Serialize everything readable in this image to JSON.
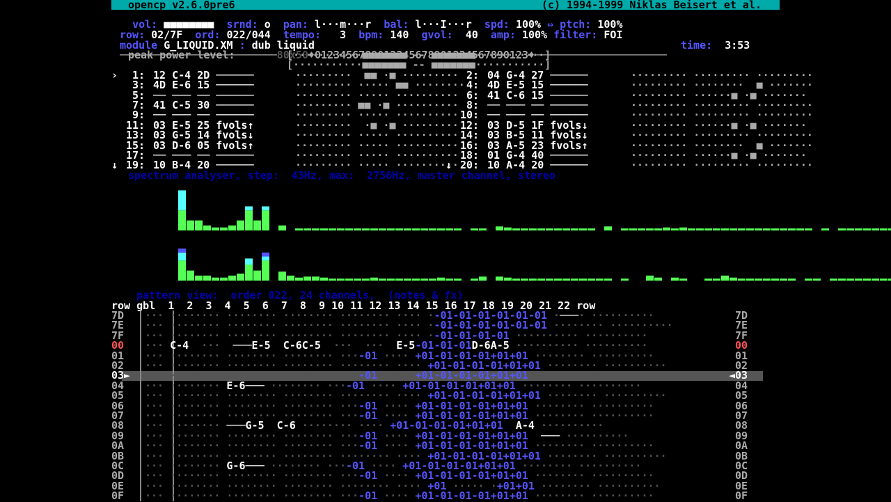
{
  "title": {
    "left": "opencp v2.6.0pre6",
    "right": "(c) 1994-1999 Niklas Beisert et al."
  },
  "header": {
    "line1": [
      {
        "label": "vol:",
        "value": "■■■■■■■■"
      },
      {
        "label": "srnd:",
        "value": "o"
      },
      {
        "label": "pan:",
        "value": "l···m···r"
      },
      {
        "label": "bal:",
        "value": "l···I···r"
      },
      {
        "label": "spd:",
        "value": "100%"
      },
      {
        "label": "⇔ ptch:",
        "value": "100%"
      }
    ],
    "row_label": "row:",
    "row_value": "02/7F",
    "ord_label": "ord:",
    "ord_value": "022/044",
    "tempo_label": "tempo:",
    "tempo_value": "3",
    "bpm_label": "bpm:",
    "bpm_value": "140",
    "gvol_label": "gvol:",
    "gvol_value": "40",
    "amp_label": "amp:",
    "amp_value": "100%",
    "filter_label": "filter:",
    "filter_value": "FOI",
    "module_label": "module",
    "module_value": "G_LIQUID.XM",
    "module_sep": ":",
    "song_title": "dub liquid",
    "time_label": "time:",
    "time_value": "3:53"
  },
  "divider": {
    "mode": "80x50",
    "channels": "♦0123456789012345678901234567890123♦",
    "left_dashes": "─────────────────────────",
    "right_dashes": "─────────────────────"
  },
  "peak": {
    "label": "peak power level:",
    "l_row": "[···········■■■■■■■ -- ■■■■■■■···········]",
    "r_row": "[···········■■■■■■■ -- ■■■■■■■···········]"
  },
  "channels_left": [
    {
      "cursor": "›",
      "num": "1:",
      "text": "12 C-4 2D ──────",
      "meter": "·········  ■■ ·■ ·········"
    },
    {
      "cursor": "",
      "num": "3:",
      "text": "4D E-6 15 ──────",
      "meter": "········· ····· ■■ ········"
    },
    {
      "cursor": "",
      "num": "5:",
      "text": "── ─── ── ──────",
      "meter": "········· ····· ··········"
    },
    {
      "cursor": "",
      "num": "7:",
      "text": "41 C-5 30 ──────",
      "meter": "········· ■■ ·■ ··········"
    },
    {
      "cursor": "",
      "num": "9:",
      "text": "── ─── ── ──────",
      "meter": "········· ····· ··········"
    },
    {
      "cursor": "",
      "num": "11:",
      "text": "03 E-5 25 fvols↑",
      "meter": "·········  ·■ ·■ ·········"
    },
    {
      "cursor": "",
      "num": "13:",
      "text": "03 G-5 14 fvols↓",
      "meter": "········· ····· ··········"
    },
    {
      "cursor": "",
      "num": "15:",
      "text": "03 D-6 05 fvols↑",
      "meter": "········· ····· ··········"
    },
    {
      "cursor": "",
      "num": "17:",
      "text": "── ─── ── ──────",
      "meter": "········· ····· ··········"
    },
    {
      "cursor": "↓",
      "num": "19:",
      "text": "10 B-4 20 ──────",
      "meter": "········· ····· ··········"
    }
  ],
  "channels_right": [
    {
      "cursor": "",
      "num": "2:",
      "text": "04 G-4 27 ──────",
      "meter": "········· ········· ·········"
    },
    {
      "cursor": "",
      "num": "4:",
      "text": "4D E-5 15 ──────",
      "meter": "········· ········  ■ ·······"
    },
    {
      "cursor": "",
      "num": "6:",
      "text": "41 C-6 15 ──────",
      "meter": "········· ······■ ·■ ·······"
    },
    {
      "cursor": "",
      "num": "8:",
      "text": "── ─── ── ──────",
      "meter": "········· ········· ·········"
    },
    {
      "cursor": "",
      "num": "10:",
      "text": "── ─── ── ──────",
      "meter": "········· ········· ·········"
    },
    {
      "cursor": "",
      "num": "12:",
      "text": "03 D-5 1F fvols↓",
      "meter": "········· ······■ ·■ ·······"
    },
    {
      "cursor": "",
      "num": "14:",
      "text": "03 B-5 11 fvols↓",
      "meter": "········· ········· ·········"
    },
    {
      "cursor": "",
      "num": "16:",
      "text": "03 A-5 23 fvols↑",
      "meter": "········· ········  ■ ·······"
    },
    {
      "cursor": "",
      "num": "18:",
      "text": "01 G-4 40 ──────",
      "meter": "········· ······■ ·■ ·······"
    },
    {
      "cursor": "↓",
      "num": "20:",
      "text": "10 A-4 20 ──────",
      "meter": "········· ········· ·········"
    }
  ],
  "spectrum": {
    "title": "spectrum analyser, step:  43Hz, max:  2756Hz, master channel, stereo",
    "colors": {
      "green": "#55ff55",
      "cyan": "#55ffff",
      "blue": "#5555ff"
    },
    "top_bars": [
      {
        "g": 2,
        "c": 2,
        "b": 0
      },
      {
        "g": 1,
        "c": 0,
        "b": 0
      },
      {
        "g": 1,
        "c": 0,
        "b": 0
      },
      {
        "g": 0.5,
        "c": 0,
        "b": 0
      },
      {
        "g": 0.3,
        "c": 0,
        "b": 0
      },
      {
        "g": 0.3,
        "c": 0,
        "b": 0
      },
      {
        "g": 0.5,
        "c": 0,
        "b": 0
      },
      {
        "g": 1,
        "c": 0,
        "b": 0
      },
      {
        "g": 2,
        "c": 0.4,
        "b": 0
      },
      {
        "g": 1,
        "c": 0,
        "b": 0
      },
      {
        "g": 2,
        "c": 0.4,
        "b": 0
      },
      {
        "g": 0,
        "c": 0,
        "b": 0
      },
      {
        "g": 0.5,
        "c": 0,
        "b": 0
      },
      {
        "g": 0,
        "c": 0,
        "b": 0
      },
      {
        "g": 0.2,
        "c": 0,
        "b": 0
      },
      {
        "g": 0.2,
        "c": 0,
        "b": 0
      },
      {
        "g": 0.2,
        "c": 0,
        "b": 0
      },
      {
        "g": 0.2,
        "c": 0,
        "b": 0
      },
      {
        "g": 0.2,
        "c": 0,
        "b": 0
      },
      {
        "g": 0.2,
        "c": 0,
        "b": 0
      },
      {
        "g": 0.2,
        "c": 0,
        "b": 0
      },
      {
        "g": 0.2,
        "c": 0,
        "b": 0
      },
      {
        "g": 0.2,
        "c": 0,
        "b": 0
      },
      {
        "g": 0.2,
        "c": 0,
        "b": 0
      },
      {
        "g": 0.2,
        "c": 0,
        "b": 0
      },
      {
        "g": 0.2,
        "c": 0,
        "b": 0
      },
      {
        "g": 0.2,
        "c": 0,
        "b": 0
      },
      {
        "g": 0.2,
        "c": 0,
        "b": 0
      },
      {
        "g": 0.2,
        "c": 0,
        "b": 0
      },
      {
        "g": 0.2,
        "c": 0,
        "b": 0
      },
      {
        "g": 0.2,
        "c": 0,
        "b": 0
      },
      {
        "g": 0.2,
        "c": 0,
        "b": 0
      },
      {
        "g": 0.2,
        "c": 0,
        "b": 0
      },
      {
        "g": 0.2,
        "c": 0,
        "b": 0
      },
      {
        "g": 0,
        "c": 0,
        "b": 0
      },
      {
        "g": 0.2,
        "c": 0,
        "b": 0
      },
      {
        "g": 0.2,
        "c": 0,
        "b": 0
      },
      {
        "g": 0,
        "c": 0,
        "b": 0
      },
      {
        "g": 0.4,
        "c": 0,
        "b": 0
      },
      {
        "g": 0.3,
        "c": 0,
        "b": 0
      },
      {
        "g": 0.2,
        "c": 0,
        "b": 0
      },
      {
        "g": 0.2,
        "c": 0,
        "b": 0
      },
      {
        "g": 0.2,
        "c": 0,
        "b": 0
      },
      {
        "g": 0.2,
        "c": 0,
        "b": 0
      },
      {
        "g": 0.2,
        "c": 0,
        "b": 0
      },
      {
        "g": 0.2,
        "c": 0,
        "b": 0
      },
      {
        "g": 0.2,
        "c": 0,
        "b": 0
      },
      {
        "g": 0.2,
        "c": 0,
        "b": 0
      },
      {
        "g": 0.2,
        "c": 0,
        "b": 0
      },
      {
        "g": 0.2,
        "c": 0,
        "b": 0
      },
      {
        "g": 0,
        "c": 0,
        "b": 0
      },
      {
        "g": 0.4,
        "c": 0,
        "b": 0
      },
      {
        "g": 0,
        "c": 0,
        "b": 0
      },
      {
        "g": 0.2,
        "c": 0,
        "b": 0
      },
      {
        "g": 0.2,
        "c": 0,
        "b": 0
      },
      {
        "g": 0.2,
        "c": 0,
        "b": 0
      },
      {
        "g": 0.2,
        "c": 0,
        "b": 0
      },
      {
        "g": 0.2,
        "c": 0,
        "b": 0
      },
      {
        "g": 0.3,
        "c": 0,
        "b": 0
      },
      {
        "g": 0.2,
        "c": 0,
        "b": 0
      },
      {
        "g": 0.3,
        "c": 0,
        "b": 0
      },
      {
        "g": 0.2,
        "c": 0,
        "b": 0
      },
      {
        "g": 0.2,
        "c": 0,
        "b": 0
      },
      {
        "g": 0.2,
        "c": 0,
        "b": 0
      },
      {
        "g": 0.2,
        "c": 0,
        "b": 0
      },
      {
        "g": 0.2,
        "c": 0,
        "b": 0
      },
      {
        "g": 0.2,
        "c": 0,
        "b": 0
      },
      {
        "g": 0.2,
        "c": 0,
        "b": 0
      },
      {
        "g": 0.2,
        "c": 0,
        "b": 0
      },
      {
        "g": 0.2,
        "c": 0,
        "b": 0
      },
      {
        "g": 0.2,
        "c": 0,
        "b": 0
      },
      {
        "g": 0.2,
        "c": 0,
        "b": 0
      },
      {
        "g": 0.2,
        "c": 0,
        "b": 0
      },
      {
        "g": 0.2,
        "c": 0,
        "b": 0
      },
      {
        "g": 0.2,
        "c": 0,
        "b": 0
      },
      {
        "g": 0.2,
        "c": 0,
        "b": 0
      },
      {
        "g": 0,
        "c": 0,
        "b": 0
      },
      {
        "g": 0.2,
        "c": 0,
        "b": 0
      },
      {
        "g": 0,
        "c": 0,
        "b": 0
      },
      {
        "g": 0.2,
        "c": 0,
        "b": 0
      },
      {
        "g": 0.2,
        "c": 0,
        "b": 0
      },
      {
        "g": 0.2,
        "c": 0,
        "b": 0
      },
      {
        "g": 0.2,
        "c": 0,
        "b": 0
      },
      {
        "g": 0.2,
        "c": 0,
        "b": 0
      },
      {
        "g": 0.2,
        "c": 0,
        "b": 0
      },
      {
        "g": 0.2,
        "c": 0,
        "b": 0
      },
      {
        "g": 0.2,
        "c": 0,
        "b": 0
      },
      {
        "g": 0.2,
        "c": 0,
        "b": 0
      },
      {
        "g": 0.2,
        "c": 0,
        "b": 0
      },
      {
        "g": 0.2,
        "c": 0,
        "b": 0
      },
      {
        "g": 0.2,
        "c": 0,
        "b": 0
      },
      {
        "g": 0.2,
        "c": 0,
        "b": 0
      }
    ],
    "bottom_bars": [
      {
        "g": 2,
        "c": 0.8,
        "b": 0.4
      },
      {
        "g": 1,
        "c": 0,
        "b": 0
      },
      {
        "g": 0.5,
        "c": 0,
        "b": 0
      },
      {
        "g": 0.5,
        "c": 0,
        "b": 0
      },
      {
        "g": 0.3,
        "c": 0,
        "b": 0
      },
      {
        "g": 0.3,
        "c": 0,
        "b": 0
      },
      {
        "g": 0.5,
        "c": 0,
        "b": 0
      },
      {
        "g": 0.7,
        "c": 0,
        "b": 0
      },
      {
        "g": 1.6,
        "c": 0.6,
        "b": 0
      },
      {
        "g": 1,
        "c": 0,
        "b": 0
      },
      {
        "g": 2,
        "c": 0.4,
        "b": 0.4
      },
      {
        "g": 0,
        "c": 0,
        "b": 0
      },
      {
        "g": 0.9,
        "c": 0,
        "b": 0
      },
      {
        "g": 0.5,
        "c": 0,
        "b": 0
      },
      {
        "g": 0.3,
        "c": 0,
        "b": 0
      },
      {
        "g": 0.4,
        "c": 0,
        "b": 0
      },
      {
        "g": 0.4,
        "c": 0,
        "b": 0
      },
      {
        "g": 0.3,
        "c": 0,
        "b": 0
      },
      {
        "g": 0.2,
        "c": 0,
        "b": 0
      },
      {
        "g": 0.2,
        "c": 0,
        "b": 0
      },
      {
        "g": 0.2,
        "c": 0,
        "b": 0
      },
      {
        "g": 0.2,
        "c": 0,
        "b": 0
      },
      {
        "g": 0.2,
        "c": 0,
        "b": 0
      },
      {
        "g": 0.3,
        "c": 0,
        "b": 0
      },
      {
        "g": 0.2,
        "c": 0,
        "b": 0
      },
      {
        "g": 0.2,
        "c": 0,
        "b": 0
      },
      {
        "g": 0.2,
        "c": 0,
        "b": 0
      },
      {
        "g": 0.2,
        "c": 0,
        "b": 0
      },
      {
        "g": 0.2,
        "c": 0,
        "b": 0
      },
      {
        "g": 0.2,
        "c": 0,
        "b": 0
      },
      {
        "g": 0.2,
        "c": 0,
        "b": 0
      },
      {
        "g": 0.3,
        "c": 0,
        "b": 0
      },
      {
        "g": 0.2,
        "c": 0,
        "b": 0
      },
      {
        "g": 0.2,
        "c": 0,
        "b": 0
      },
      {
        "g": 0,
        "c": 0,
        "b": 0
      },
      {
        "g": 0.2,
        "c": 0,
        "b": 0
      },
      {
        "g": 0.4,
        "c": 0,
        "b": 0
      },
      {
        "g": 0,
        "c": 0,
        "b": 0
      },
      {
        "g": 0.4,
        "c": 0,
        "b": 0
      },
      {
        "g": 0.3,
        "c": 0,
        "b": 0
      },
      {
        "g": 0.2,
        "c": 0,
        "b": 0
      },
      {
        "g": 0.2,
        "c": 0,
        "b": 0
      },
      {
        "g": 0.2,
        "c": 0,
        "b": 0
      },
      {
        "g": 0.2,
        "c": 0,
        "b": 0
      },
      {
        "g": 0.2,
        "c": 0,
        "b": 0
      },
      {
        "g": 0.2,
        "c": 0,
        "b": 0
      },
      {
        "g": 0.2,
        "c": 0,
        "b": 0
      },
      {
        "g": 0.2,
        "c": 0,
        "b": 0
      },
      {
        "g": 0.2,
        "c": 0,
        "b": 0
      },
      {
        "g": 0.2,
        "c": 0,
        "b": 0
      },
      {
        "g": 0.2,
        "c": 0,
        "b": 0
      },
      {
        "g": 0.2,
        "c": 0,
        "b": 0
      },
      {
        "g": 0,
        "c": 0,
        "b": 0
      },
      {
        "g": 0.2,
        "c": 0,
        "b": 0
      },
      {
        "g": 0,
        "c": 0,
        "b": 0
      },
      {
        "g": 0,
        "c": 0,
        "b": 0
      },
      {
        "g": 0.5,
        "c": 0,
        "b": 0
      },
      {
        "g": 0.3,
        "c": 0,
        "b": 0
      },
      {
        "g": 0,
        "c": 0,
        "b": 0
      },
      {
        "g": 0.3,
        "c": 0,
        "b": 0
      },
      {
        "g": 0.2,
        "c": 0,
        "b": 0
      },
      {
        "g": 0,
        "c": 0,
        "b": 0
      },
      {
        "g": 0,
        "c": 0,
        "b": 0
      },
      {
        "g": 0.2,
        "c": 0,
        "b": 0
      },
      {
        "g": 0.2,
        "c": 0,
        "b": 0
      },
      {
        "g": 0.5,
        "c": 0,
        "b": 0
      },
      {
        "g": 0.3,
        "c": 0,
        "b": 0
      },
      {
        "g": 0.2,
        "c": 0,
        "b": 0
      },
      {
        "g": 0.2,
        "c": 0,
        "b": 0
      },
      {
        "g": 0.2,
        "c": 0,
        "b": 0
      },
      {
        "g": 0.2,
        "c": 0,
        "b": 0
      },
      {
        "g": 0.2,
        "c": 0,
        "b": 0
      },
      {
        "g": 0.2,
        "c": 0,
        "b": 0
      },
      {
        "g": 0.2,
        "c": 0,
        "b": 0
      },
      {
        "g": 0,
        "c": 0,
        "b": 0
      },
      {
        "g": 0.2,
        "c": 0,
        "b": 0
      },
      {
        "g": 0.2,
        "c": 0,
        "b": 0
      },
      {
        "g": 0,
        "c": 0,
        "b": 0
      },
      {
        "g": 0.2,
        "c": 0,
        "b": 0
      },
      {
        "g": 0.2,
        "c": 0,
        "b": 0
      },
      {
        "g": 0.2,
        "c": 0,
        "b": 0
      },
      {
        "g": 0.2,
        "c": 0,
        "b": 0
      },
      {
        "g": 0.2,
        "c": 0,
        "b": 0
      },
      {
        "g": 0.2,
        "c": 0,
        "b": 0
      },
      {
        "g": 0.2,
        "c": 0,
        "b": 0
      },
      {
        "g": 0.2,
        "c": 0,
        "b": 0
      },
      {
        "g": 0.2,
        "c": 0,
        "b": 0
      },
      {
        "g": 0.2,
        "c": 0,
        "b": 0
      },
      {
        "g": 0.2,
        "c": 0,
        "b": 0
      },
      {
        "g": 0.2,
        "c": 0,
        "b": 0
      },
      {
        "g": 0.2,
        "c": 0,
        "b": 0
      },
      {
        "g": 0.2,
        "c": 0,
        "b": 0
      }
    ]
  },
  "pattern": {
    "title": "pattern view:  order 022, 24 channels,  (notes & fx)",
    "header": "row gbl  1  2  3  4  5  6  7  8  9 10 11 12 13 14 15 16 17 18 19 20 21 22 row",
    "current_row": "03",
    "rows": [
      {
        "row": "7D",
        "cells": "··· ········ ········ ········ ········ ···· ·-01-01-01-01-01-01 ·───· ··········",
        "cls": "g"
      },
      {
        "row": "7E",
        "cells": "··· ········ ········ ········ ········ ···· ·-01-01-01-01-01-01 ········ ··········",
        "cls": "g"
      },
      {
        "row": "7F",
        "cells": "··· ········ ········ ········ ········ ···· ·-01-01-01-01 ·········· ··········",
        "cls": "g"
      },
      {
        "row": "00",
        "cells": "··· C-4  ···  ───E-5  C-6C-5  ···  ···  E-5-01-01-01D-6A-5 ·········· ··········",
        "cls": "w"
      },
      {
        "row": "01",
        "cells": "··· ········ ········ ········ ···-01 ···· +01-01-01-01+01+01 ········ ··········",
        "cls": "g"
      },
      {
        "row": "02",
        "cells": "··· ········ ········ ········ ········ ···· +01-01-01-01+01+01 ········ ··········",
        "cls": "g"
      },
      {
        "row": "03",
        "cells": "··· ········ ········ ········ ···-01 ···· +01-01-01-01+01+01 ········ ··········",
        "cls": "g"
      },
      {
        "row": "04",
        "cells": "··· ········ E-6─── ········ ···-01 ···· +01-01-01-01+01+01 ········ ··········",
        "cls": "g"
      },
      {
        "row": "05",
        "cells": "··· ········ ········ ········ ········ ···· +01-01-01-01+01+01 ········ ··········",
        "cls": "g"
      },
      {
        "row": "06",
        "cells": "··· ········ ········ ········ ···-01 ···· +01-01-01-01+01+01 ········ ··········",
        "cls": "g"
      },
      {
        "row": "07",
        "cells": "··· ········ ········ ········ ···-01 ···· +01-01-01-01+01+01 ········ ··········",
        "cls": "g"
      },
      {
        "row": "08",
        "cells": "··· ········ ───G-5  C-6 ········ ···· +01-01-01-01+01+01  A-4 ··········",
        "cls": "g"
      },
      {
        "row": "09",
        "cells": "··· ········ ········ ········ ···-01 ···· +01-01-01-01+01+01  ─── ··········",
        "cls": "g"
      },
      {
        "row": "0A",
        "cells": "··· ········ ········ ········ ···-01 ···· +01-01-01-01+01+01 ········ ··········",
        "cls": "g"
      },
      {
        "row": "0B",
        "cells": "··· ········ ········ ········ ········ ···· +01-01-01-01+01+01 ········ ··········",
        "cls": "g"
      },
      {
        "row": "0C",
        "cells": "··· ········ G-6─── ········ ···-01 ···· +01-01-01-01+01+01 ········ ··········",
        "cls": "g"
      },
      {
        "row": "0D",
        "cells": "··· ········ ········ ········ ···-01 ···· +01-01-01-01+01+01 ········ ··········",
        "cls": "g"
      },
      {
        "row": "0E",
        "cells": "··· ········ ········ ········ ········ ···· +01 ····· ·+01+01 ········ ··········",
        "cls": "g"
      },
      {
        "row": "0F",
        "cells": "··· ········ ········ ········ ···-01 ···· +01-01-01-01+01+01 ········ ··········",
        "cls": "g"
      }
    ]
  }
}
